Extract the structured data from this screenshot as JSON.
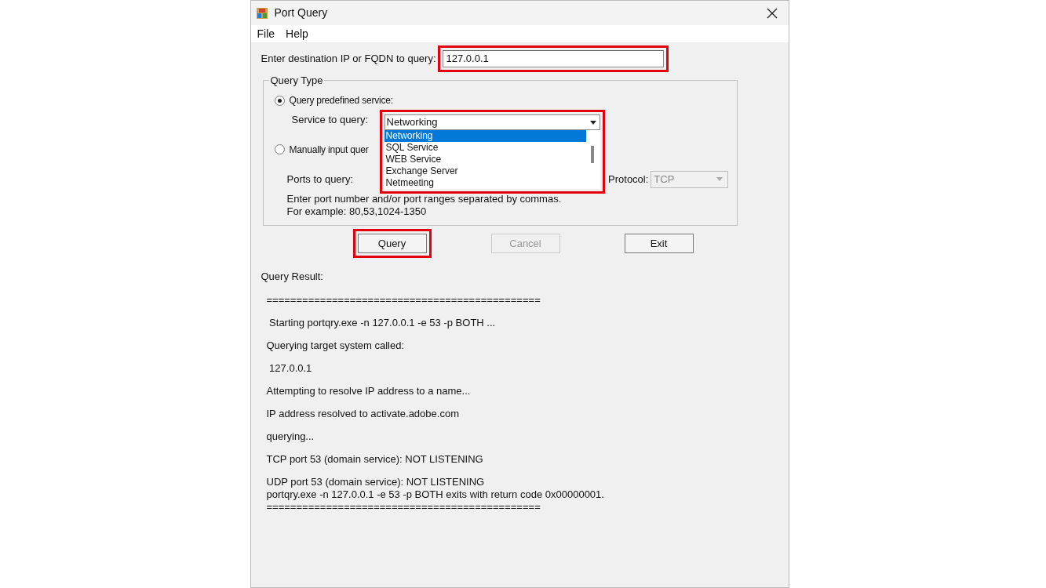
{
  "window": {
    "title": "Port Query"
  },
  "menu": [
    {
      "label": "File"
    },
    {
      "label": "Help"
    }
  ],
  "destination": {
    "label": "Enter destination IP or FQDN to query:",
    "value": "127.0.0.1",
    "highlighted": true
  },
  "query_type": {
    "title": "Query Type",
    "options": [
      {
        "label": "Query predefined service:",
        "selected": true
      },
      {
        "label": "Manually input quer",
        "selected": false
      }
    ],
    "service": {
      "label": "Service to query:",
      "value": "Networking",
      "highlighted": true,
      "expanded": true,
      "items": [
        {
          "label": "Networking",
          "selected": true
        },
        {
          "label": "SQL Service",
          "selected": false
        },
        {
          "label": "WEB Service",
          "selected": false
        },
        {
          "label": "Exchange Server",
          "selected": false
        },
        {
          "label": "Netmeeting",
          "selected": false
        }
      ]
    },
    "ports": {
      "label": "Ports to query:"
    },
    "protocol": {
      "label": "Protocol:",
      "value": "TCP",
      "disabled": true
    },
    "hint": [
      "Enter port number and/or port ranges separated by commas.",
      "For example: 80,53,1024-1350"
    ]
  },
  "buttons": [
    {
      "label": "Query",
      "disabled": false,
      "highlighted": true
    },
    {
      "label": "Cancel",
      "disabled": true,
      "highlighted": false
    },
    {
      "label": "Exit",
      "disabled": false,
      "highlighted": false
    }
  ],
  "result": {
    "title": "Query Result:",
    "blocks": [
      [
        "=============================================="
      ],
      [
        " Starting portqry.exe -n 127.0.0.1 -e 53 -p BOTH ..."
      ],
      [
        "Querying target system called:"
      ],
      [
        " 127.0.0.1"
      ],
      [
        "Attempting to resolve IP address to a name..."
      ],
      [
        "IP address resolved to activate.adobe.com"
      ],
      [
        "querying..."
      ],
      [
        "TCP port 53 (domain service): NOT LISTENING"
      ],
      [
        "UDP port 53 (domain service): NOT LISTENING",
        "portqry.exe -n 127.0.0.1 -e 53 -p BOTH exits with return code 0x00000001.",
        "=============================================="
      ]
    ]
  }
}
